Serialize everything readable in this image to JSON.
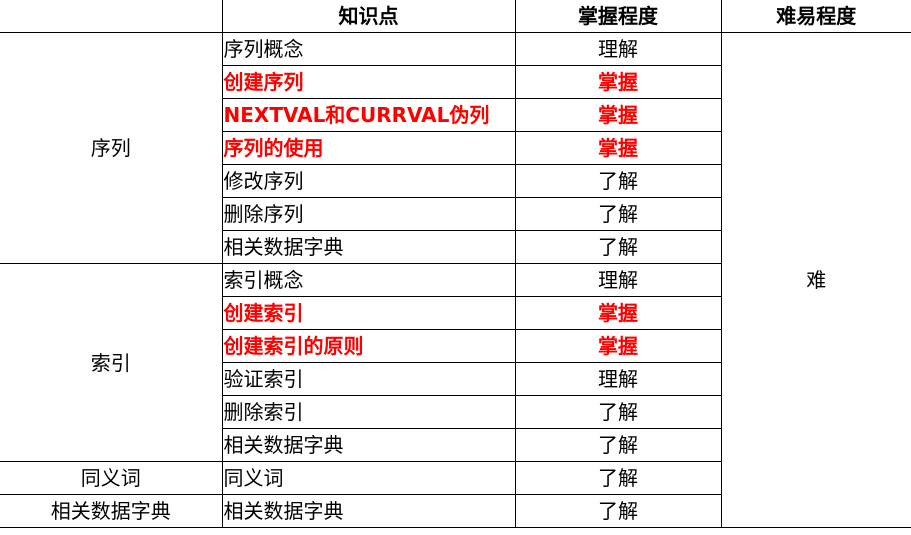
{
  "header": {
    "col1": "",
    "col2": "知识点",
    "col3": "掌握程度",
    "col4": "难易程度"
  },
  "groups": [
    {
      "name": "序列",
      "rows": [
        {
          "point": "序列概念",
          "level": "理解",
          "emphasis": false
        },
        {
          "point": "创建序列",
          "level": "掌握",
          "emphasis": true
        },
        {
          "point": "NEXTVAL和CURRVAL伪列",
          "level": "掌握",
          "emphasis": true
        },
        {
          "point": "序列的使用",
          "level": "掌握",
          "emphasis": true
        },
        {
          "point": "修改序列",
          "level": "了解",
          "emphasis": false
        },
        {
          "point": "删除序列",
          "level": "了解",
          "emphasis": false
        },
        {
          "point": "相关数据字典",
          "level": "了解",
          "emphasis": false
        }
      ]
    },
    {
      "name": "索引",
      "rows": [
        {
          "point": "索引概念",
          "level": "理解",
          "emphasis": false
        },
        {
          "point": "创建索引",
          "level": "掌握",
          "emphasis": true
        },
        {
          "point": "创建索引的原则",
          "level": "掌握",
          "emphasis": true
        },
        {
          "point": "验证索引",
          "level": "理解",
          "emphasis": false
        },
        {
          "point": "删除索引",
          "level": "了解",
          "emphasis": false
        },
        {
          "point": "相关数据字典",
          "level": "了解",
          "emphasis": false
        }
      ]
    },
    {
      "name": "同义词",
      "rows": [
        {
          "point": "同义词",
          "level": "了解",
          "emphasis": false
        }
      ]
    },
    {
      "name": "相关数据字典",
      "rows": [
        {
          "point": "相关数据字典",
          "level": "了解",
          "emphasis": false
        }
      ]
    }
  ],
  "difficulty": "难",
  "colors": {
    "emphasis": "#ff0000",
    "text": "#000000",
    "border": "#000000"
  }
}
